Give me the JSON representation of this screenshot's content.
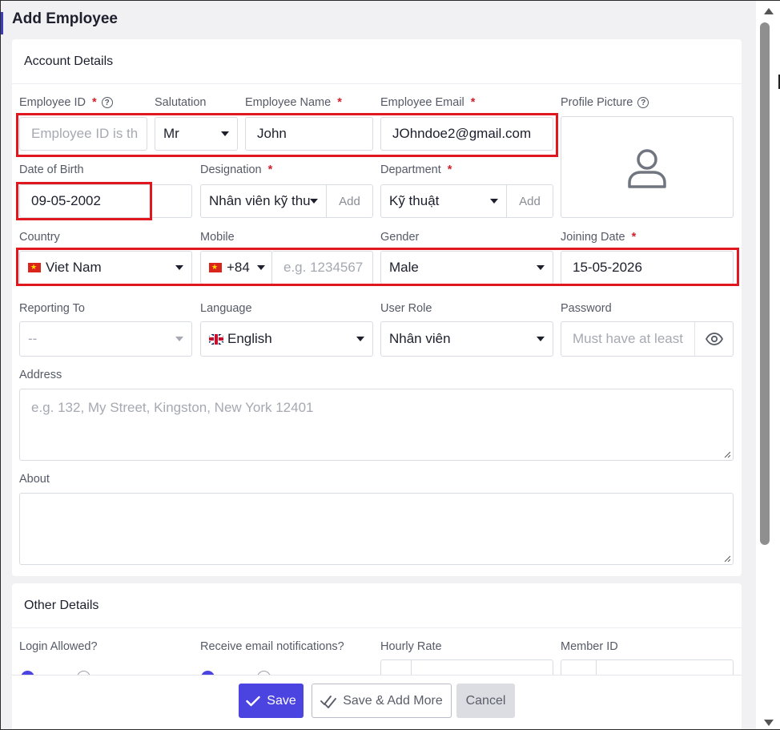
{
  "modal": {
    "title": "Add Employee"
  },
  "account": {
    "section_title": "Account Details",
    "employee_id": {
      "label": "Employee ID",
      "placeholder": "Employee ID is th"
    },
    "salutation": {
      "label": "Salutation",
      "value": "Mr"
    },
    "employee_name": {
      "label": "Employee Name",
      "value": "John"
    },
    "employee_email": {
      "label": "Employee Email",
      "value": "JOhndoe2@gmail.com"
    },
    "profile_picture": {
      "label": "Profile Picture"
    },
    "dob": {
      "label": "Date of Birth",
      "value": "09-05-2002"
    },
    "designation": {
      "label": "Designation",
      "value": "Nhân viên kỹ thu",
      "add": "Add"
    },
    "department": {
      "label": "Department",
      "value": "Kỹ thuật",
      "add": "Add"
    },
    "country": {
      "label": "Country",
      "value": "Viet Nam"
    },
    "mobile": {
      "label": "Mobile",
      "code": "+84",
      "placeholder": "e.g. 1234567"
    },
    "gender": {
      "label": "Gender",
      "value": "Male"
    },
    "joining_date": {
      "label": "Joining Date",
      "value": "15-05-2026"
    },
    "reporting_to": {
      "label": "Reporting To",
      "value": "--"
    },
    "language": {
      "label": "Language",
      "value": "English"
    },
    "user_role": {
      "label": "User Role",
      "value": "Nhân viên"
    },
    "password": {
      "label": "Password",
      "placeholder": "Must have at least"
    },
    "address": {
      "label": "Address",
      "placeholder": "e.g. 132, My Street, Kingston, New York 12401"
    },
    "about": {
      "label": "About"
    }
  },
  "other": {
    "section_title": "Other Details",
    "login_allowed": {
      "label": "Login Allowed?"
    },
    "email_notifications": {
      "label": "Receive email notifications?"
    },
    "hourly_rate": {
      "label": "Hourly Rate"
    },
    "member_id": {
      "label": "Member ID"
    }
  },
  "footer": {
    "save": "Save",
    "save_more": "Save & Add More",
    "cancel": "Cancel"
  },
  "colors": {
    "primary": "#4c44e0",
    "required": "#d21f2b",
    "highlight": "#e0171e"
  }
}
